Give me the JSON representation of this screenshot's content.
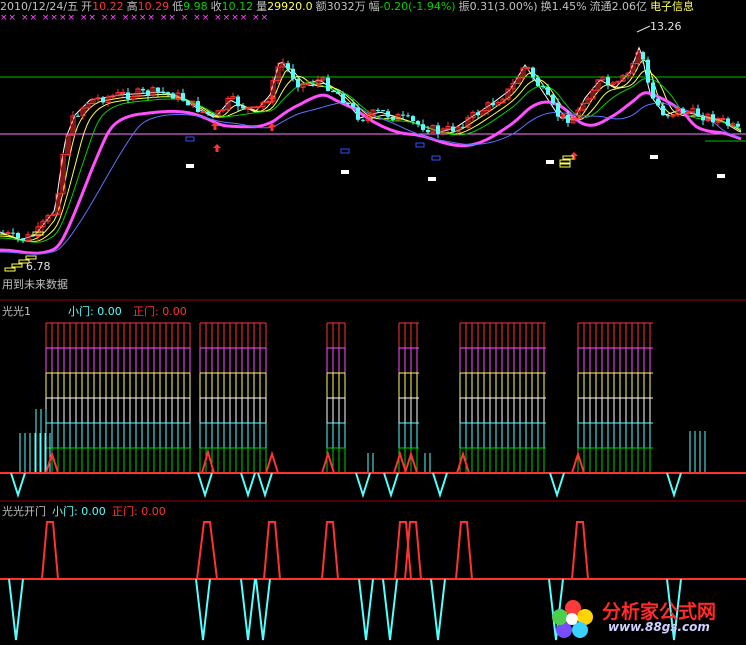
{
  "header": {
    "date": "2010/12/24/五",
    "open_label": "开",
    "open": "10.22",
    "high_label": "高",
    "high": "10.29",
    "low_label": "低",
    "low": "9.98",
    "close_label": "收",
    "close": "10.12",
    "vol_label": "量",
    "vol": "29920.0",
    "amt_label": "额",
    "amt": "3032万",
    "chg_label": "幅",
    "chg": "-0.20(-1.94%)",
    "amp_label": "振",
    "amp": "0.31(3.00%)",
    "turn_label": "换",
    "turn": "1.45%",
    "float_label": "流通",
    "float": "2.06亿",
    "sector": "电子信息",
    "marks": "×× ×× ×××× ×× ×× ×××× ×× × ×× ×××× ××"
  },
  "main_panel": {
    "high_label": "13.26",
    "low_label": "6.78",
    "future_label": "用到未来数据",
    "colors": {
      "up": "#ff3232",
      "down": "#54ffff",
      "band_line": "#00c000",
      "band_line2": "#ff80ff"
    }
  },
  "panel1": {
    "title": "光光1",
    "small_door_label": "小门: 0.00",
    "main_door_label": "正门: 0.00",
    "colors": {
      "small": "#54ffff",
      "main": "#ff3232"
    }
  },
  "panel2": {
    "title": "光光开门",
    "small_door_label": "小门: 0.00",
    "main_door_label": "正门: 0.00"
  },
  "watermark": {
    "name": "分析家公式网",
    "url": "www.88gs.com"
  },
  "chart_data": [
    {
      "type": "candlestick",
      "title": "",
      "x_last": "2010/12/24",
      "last_bar": {
        "open": 10.22,
        "high": 10.29,
        "low": 9.98,
        "close": 10.12
      },
      "max_high": 13.26,
      "min_low": 6.78
    },
    {
      "type": "bar",
      "title": "光光1",
      "series": [
        {
          "name": "小门",
          "value": 0.0
        },
        {
          "name": "正门",
          "value": 0.0
        }
      ]
    },
    {
      "type": "line",
      "title": "光光开门",
      "series": [
        {
          "name": "小门",
          "value": 0.0
        },
        {
          "name": "正门",
          "value": 0.0
        }
      ]
    }
  ]
}
